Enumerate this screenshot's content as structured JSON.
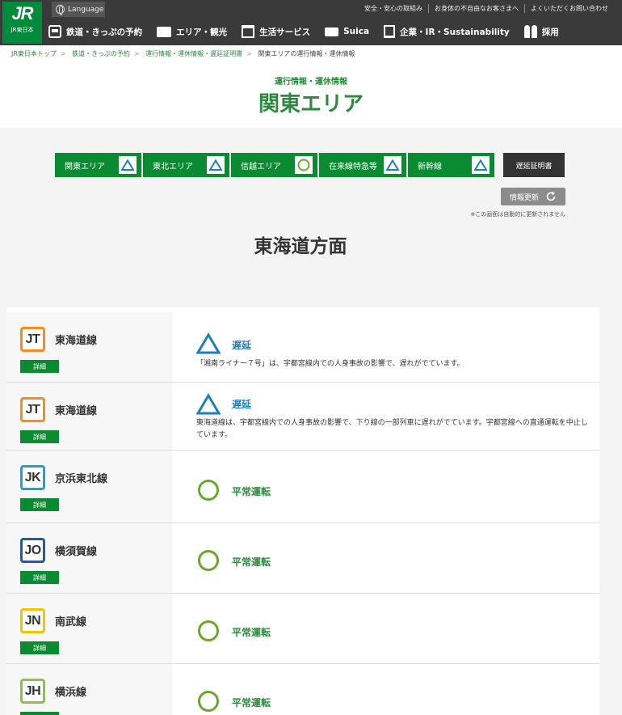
{
  "header": {
    "logo_text": "JR",
    "logo_sub": "JR東日本",
    "language_label": "Language",
    "top_links": [
      "安全・安心の取組み",
      "お身体の不自由なお客さまへ",
      "よくいただくお問い合わせ"
    ],
    "nav": [
      {
        "label": "鉄道・きっぷの予約",
        "icon": "train-icon"
      },
      {
        "label": "エリア・観光",
        "icon": "suitcase-icon"
      },
      {
        "label": "生活サービス",
        "icon": "shopping-bag-icon"
      },
      {
        "label": "Suica",
        "icon": "card-icon"
      },
      {
        "label": "企業・IR・Sustainability",
        "icon": "building-icon"
      },
      {
        "label": "採用",
        "icon": "people-icon"
      }
    ]
  },
  "breadcrumb": [
    "JR東日本トップ",
    "鉄道・きっぷの予約",
    "運行情報・運休情報・遅延証明書",
    "関東エリアの運行情報・運休情報"
  ],
  "page": {
    "subtitle": "運行情報・運休情報",
    "title": "関東エリア"
  },
  "tabs": [
    {
      "label": "関東エリア",
      "status": "delay"
    },
    {
      "label": "東北エリア",
      "status": "delay"
    },
    {
      "label": "信越エリア",
      "status": "normal"
    },
    {
      "label": "在来線特急等",
      "status": "delay"
    },
    {
      "label": "新幹線",
      "status": "delay"
    }
  ],
  "cert_button": "遅延証明書",
  "refresh_button": "情報更新",
  "auto_note": "※この画面は自動的に更新されません",
  "area_heading": "東海道方面",
  "detail_label": "詳細",
  "lines": [
    {
      "code": "JT",
      "name": "東海道線",
      "color": "#f68b1e",
      "status": "遅延",
      "status_type": "delay",
      "description": "「湘南ライナー７号」は、宇都宮線内での人身事故の影響で、遅れがでています。"
    },
    {
      "code": "JT",
      "name": "東海道線",
      "color": "#f68b1e",
      "status": "遅延",
      "status_type": "delay",
      "description": "東海道線は、宇都宮線内での人身事故の影響で、下り線の一部列車に遅れがでています。宇都宮線への直通運転を中止しています。"
    },
    {
      "code": "JK",
      "name": "京浜東北線",
      "color": "#1da1d8",
      "status": "平常運転",
      "status_type": "normal",
      "description": ""
    },
    {
      "code": "JO",
      "name": "横須賀線",
      "color": "#1f5ca8",
      "status": "平常運転",
      "status_type": "normal",
      "description": ""
    },
    {
      "code": "JN",
      "name": "南武線",
      "color": "#f5c400",
      "status": "平常運転",
      "status_type": "normal",
      "description": ""
    },
    {
      "code": "JH",
      "name": "横浜線",
      "color": "#8bc34a",
      "status": "平常運転",
      "status_type": "normal",
      "description": ""
    }
  ],
  "colors": {
    "brand_green": "#0b8b31",
    "delay_blue": "#1d7fbd",
    "normal_green": "#6aa82a"
  }
}
